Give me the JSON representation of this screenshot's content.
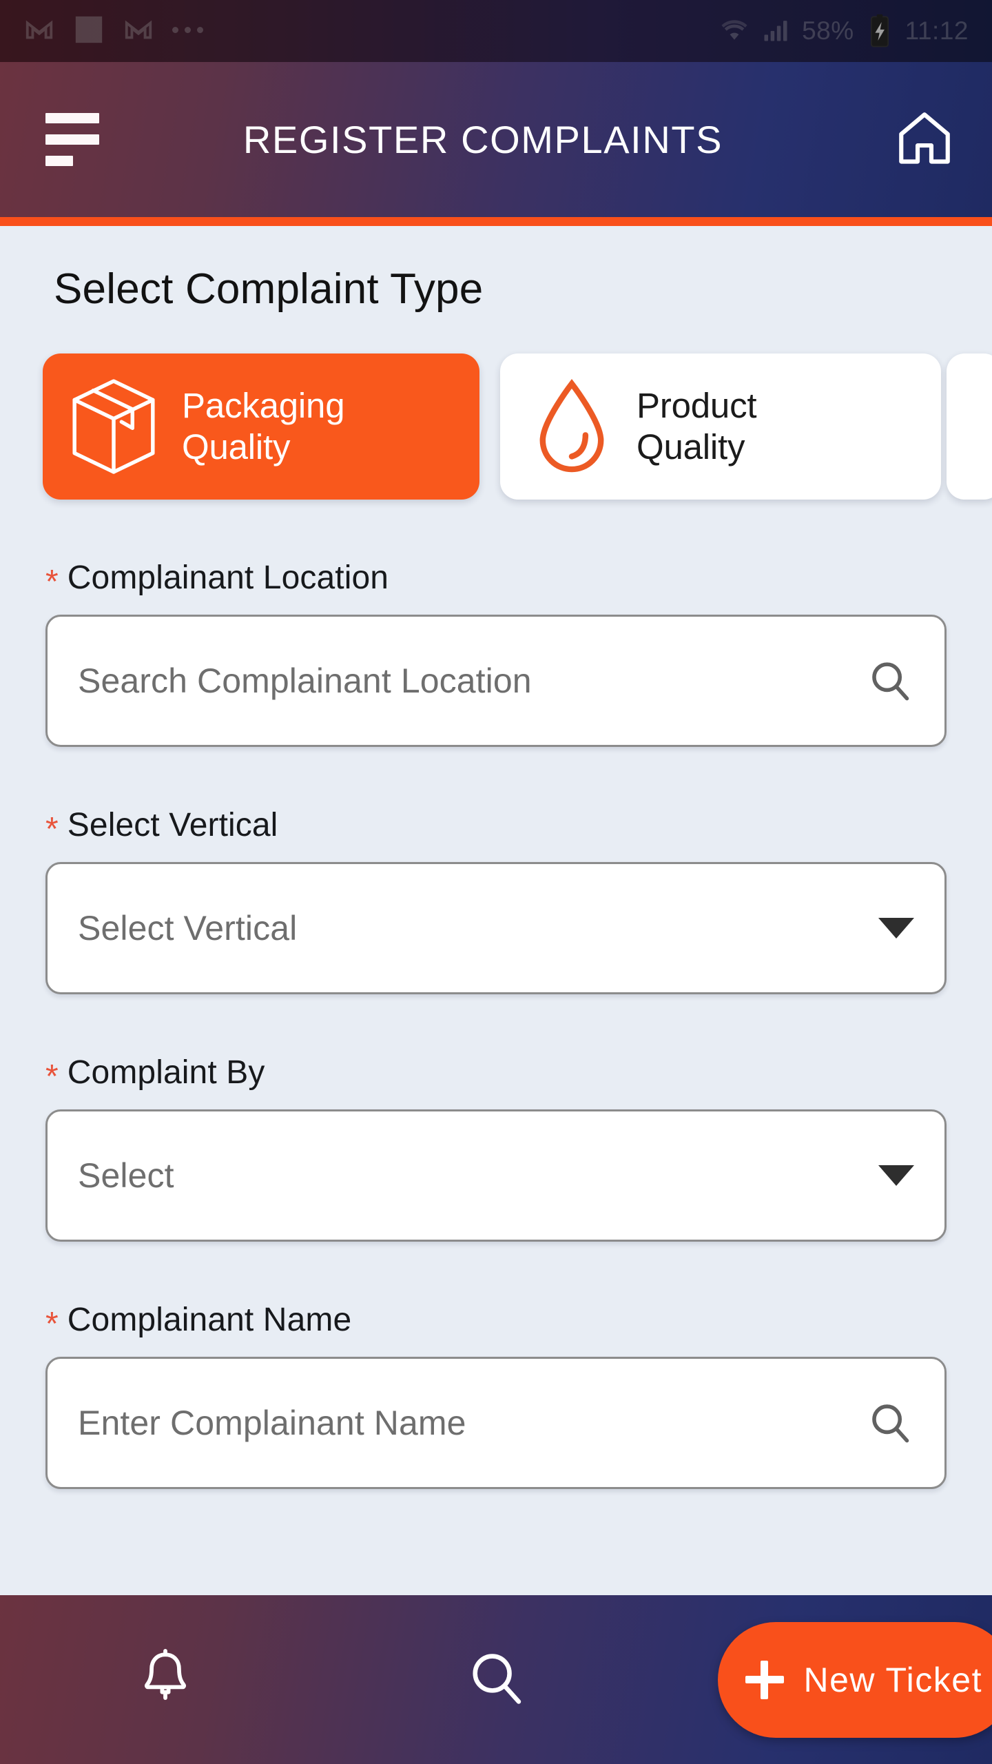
{
  "status_bar": {
    "notification_icons": [
      "gmail-icon",
      "flipboard-icon",
      "gmail-icon",
      "more-dots-icon"
    ],
    "wifi_icon": "wifi-icon",
    "signal_icon": "cellular-signal-icon",
    "battery_percent": "58%",
    "battery_icon": "battery-charging-icon",
    "time": "11:12"
  },
  "header": {
    "menu_icon": "hamburger-menu-icon",
    "title": "REGISTER COMPLAINTS",
    "home_icon": "home-icon",
    "gradient_from": "#6b3340",
    "gradient_to": "#1f2a62",
    "accent_color": "#f9501b"
  },
  "main": {
    "section_title": "Select Complaint Type",
    "complaint_types": [
      {
        "label_line1": "Packaging",
        "label_line2": "Quality",
        "icon": "package-box-icon",
        "selected": true
      },
      {
        "label_line1": "Product",
        "label_line2": "Quality",
        "icon": "water-drop-icon",
        "selected": false
      }
    ],
    "fields": [
      {
        "label": "Complainant Location",
        "required_marker": "*",
        "placeholder": "Search Complainant Location",
        "value": "",
        "control": "search",
        "icon": "search-icon"
      },
      {
        "label": "Select Vertical",
        "required_marker": "*",
        "placeholder": "Select Vertical",
        "value": "",
        "control": "dropdown",
        "icon": "chevron-down-icon"
      },
      {
        "label": "Complaint By",
        "required_marker": "*",
        "placeholder": "Select",
        "value": "",
        "control": "dropdown",
        "icon": "chevron-down-icon"
      },
      {
        "label": "Complainant Name",
        "required_marker": "*",
        "placeholder": "Enter Complainant Name",
        "value": "",
        "control": "search",
        "icon": "search-icon"
      }
    ]
  },
  "bottom_bar": {
    "notifications_icon": "bell-icon",
    "search_icon": "search-icon",
    "new_ticket_label": "New Ticket",
    "new_ticket_plus_icon": "plus-icon",
    "new_ticket_color": "#f9501b"
  },
  "theme": {
    "accent_orange": "#f9501b",
    "card_orange": "#f9581c",
    "page_background": "#e8edf4",
    "required_red": "#e8543b"
  }
}
